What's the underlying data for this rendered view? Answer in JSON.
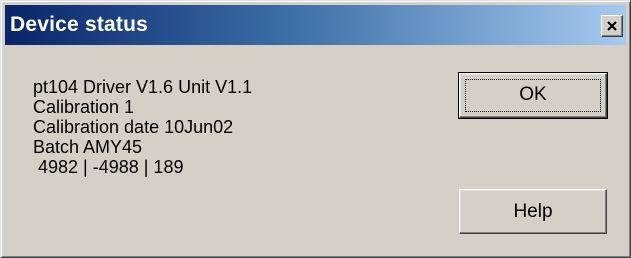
{
  "window": {
    "title": "Device status"
  },
  "info_lines": [
    "pt104 Driver V1.6 Unit V1.1",
    "Calibration 1",
    "Calibration date 10Jun02",
    "Batch AMY45",
    " 4982 | -4988 | 189"
  ],
  "buttons": {
    "ok_label": "OK",
    "help_label": "Help"
  },
  "icons": {
    "close": "close-icon"
  }
}
